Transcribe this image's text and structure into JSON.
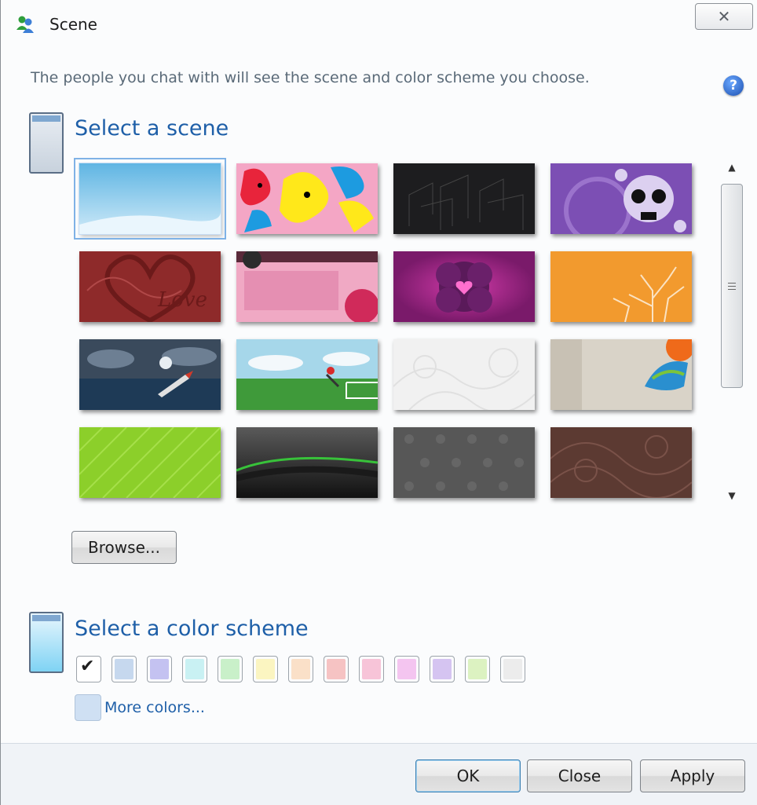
{
  "window": {
    "title": "Scene",
    "close_symbol": "✕",
    "app_icon": "messenger-buddies-icon"
  },
  "intro_text": "The people you chat with will see the scene and color scheme you choose.",
  "help_icon": "?",
  "scene_section": {
    "title": "Select a scene",
    "thumbnails": [
      {
        "name": "light-blue-sky",
        "selected": true
      },
      {
        "name": "colorful-blobs",
        "selected": false
      },
      {
        "name": "dark-geometric-lines",
        "selected": false
      },
      {
        "name": "purple-skull",
        "selected": false
      },
      {
        "name": "red-love-swirl",
        "selected": false
      },
      {
        "name": "pink-grunge",
        "selected": false
      },
      {
        "name": "magenta-heart",
        "selected": false
      },
      {
        "name": "orange-tree",
        "selected": false
      },
      {
        "name": "ocean-rocket",
        "selected": false
      },
      {
        "name": "soccer-field",
        "selected": false
      },
      {
        "name": "white-swirls",
        "selected": false
      },
      {
        "name": "wall-graffiti",
        "selected": false
      },
      {
        "name": "green-stripes",
        "selected": false
      },
      {
        "name": "black-green-wave",
        "selected": false
      },
      {
        "name": "gray-damask",
        "selected": false
      },
      {
        "name": "brown-swirls",
        "selected": false
      }
    ],
    "browse_label": "Browse..."
  },
  "color_section": {
    "title": "Select a color scheme",
    "check_symbol": "✔",
    "swatches": [
      {
        "color": "#ffffff",
        "selected": true
      },
      {
        "color": "#c6d8ee",
        "selected": false
      },
      {
        "color": "#c4c2f1",
        "selected": false
      },
      {
        "color": "#c9f1f3",
        "selected": false
      },
      {
        "color": "#c9f0c9",
        "selected": false
      },
      {
        "color": "#fbf5c1",
        "selected": false
      },
      {
        "color": "#fae0c8",
        "selected": false
      },
      {
        "color": "#f6c3c3",
        "selected": false
      },
      {
        "color": "#f7c4d8",
        "selected": false
      },
      {
        "color": "#f4c5f0",
        "selected": false
      },
      {
        "color": "#d5c4f1",
        "selected": false
      },
      {
        "color": "#dcf2c1",
        "selected": false
      },
      {
        "color": "#ececec",
        "selected": false
      }
    ],
    "more_colors_label": "More colors..."
  },
  "buttons": {
    "ok": "OK",
    "close": "Close",
    "apply": "Apply"
  },
  "scrollbar": {
    "up_symbol": "▲",
    "down_symbol": "▼"
  }
}
